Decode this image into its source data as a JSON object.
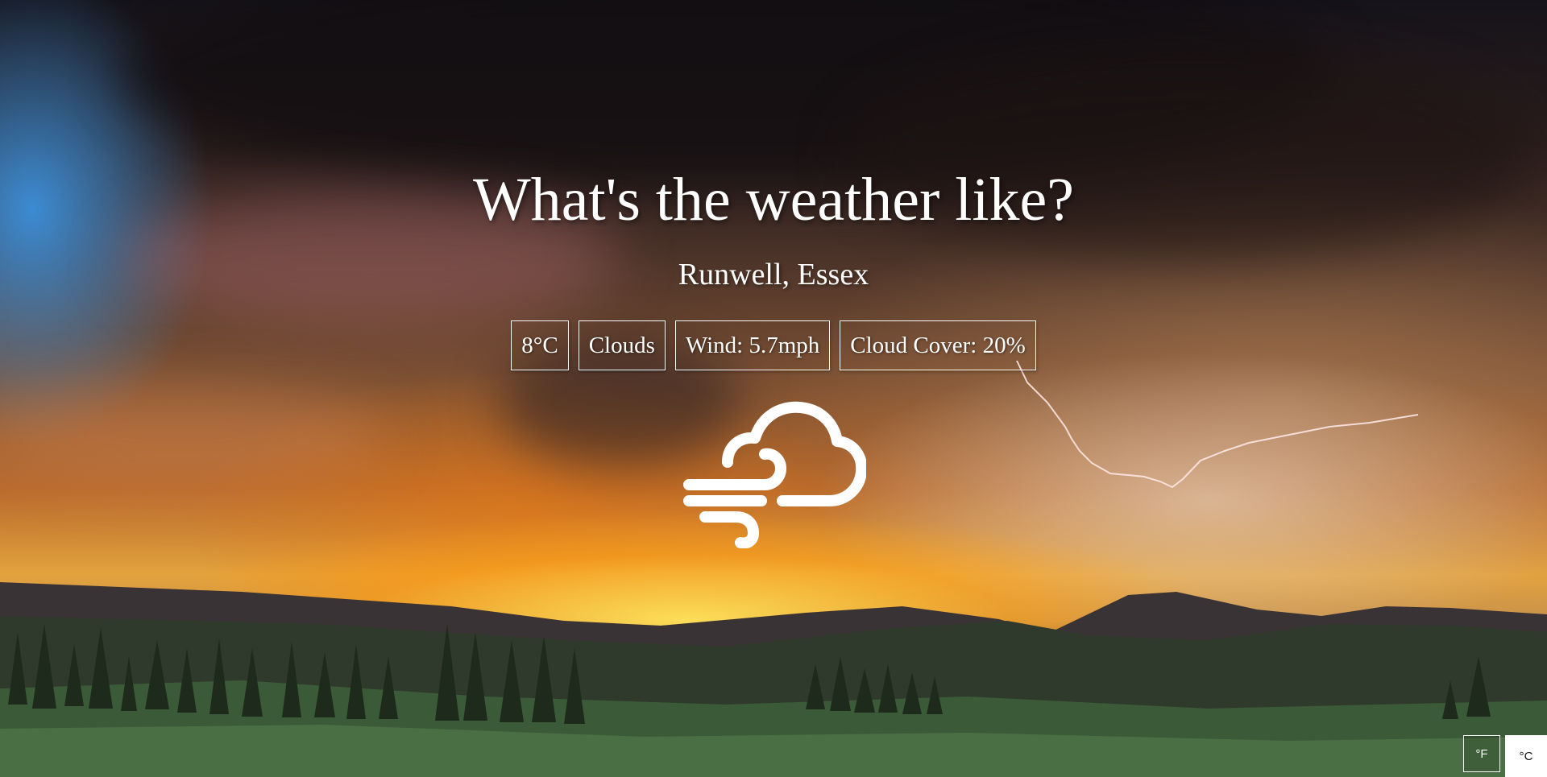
{
  "page": {
    "title": "What's the weather like?",
    "location": "Runwell, Essex"
  },
  "weather": {
    "temperature": "8°C",
    "condition": "Clouds",
    "wind": "Wind: 5.7mph",
    "cloud_cover": "Cloud Cover: 20%",
    "icon": "wind-cloud-icon"
  },
  "units": {
    "fahrenheit_label": "°F",
    "celsius_label": "°C",
    "selected": "°C"
  },
  "colors": {
    "text": "#ffffff",
    "selected_unit_bg": "#ffffff"
  }
}
